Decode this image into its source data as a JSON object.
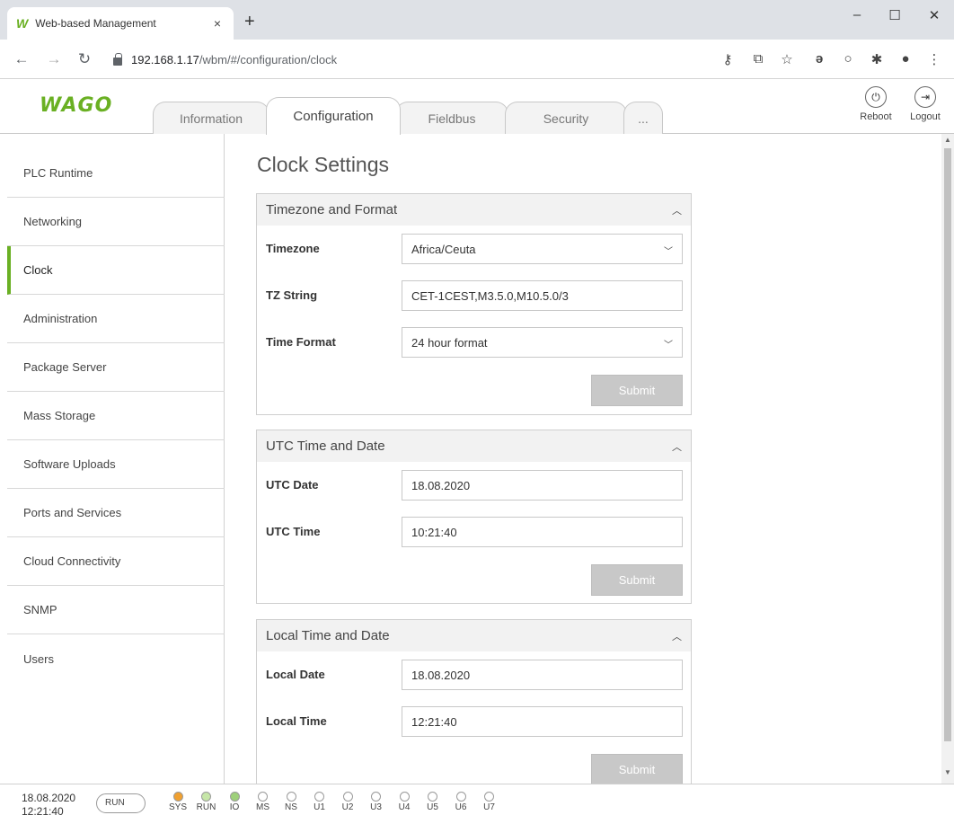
{
  "browser": {
    "tab_title": "Web-based Management",
    "tab_favicon": "W",
    "tab_close": "×",
    "new_tab": "+",
    "win_minimize": "–",
    "win_maximize": "☐",
    "win_close": "✕",
    "url_host": "192.168.1.17",
    "url_path": "/wbm/#/configuration/clock"
  },
  "app": {
    "logo": "WAGO",
    "tabs": [
      {
        "label": "Information"
      },
      {
        "label": "Configuration"
      },
      {
        "label": "Fieldbus"
      },
      {
        "label": "Security"
      },
      {
        "label": "..."
      }
    ],
    "reboot_label": "Reboot",
    "logout_label": "Logout"
  },
  "sidebar": {
    "items": [
      {
        "label": "PLC Runtime"
      },
      {
        "label": "Networking"
      },
      {
        "label": "Clock"
      },
      {
        "label": "Administration"
      },
      {
        "label": "Package Server"
      },
      {
        "label": "Mass Storage"
      },
      {
        "label": "Software Uploads"
      },
      {
        "label": "Ports and Services"
      },
      {
        "label": "Cloud Connectivity"
      },
      {
        "label": "SNMP"
      },
      {
        "label": "Users"
      }
    ]
  },
  "page": {
    "title": "Clock Settings",
    "timezone_panel": {
      "title": "Timezone and Format",
      "timezone_label": "Timezone",
      "timezone_value": "Africa/Ceuta",
      "tzstring_label": "TZ String",
      "tzstring_value": "CET-1CEST,M3.5.0,M10.5.0/3",
      "timeformat_label": "Time Format",
      "timeformat_value": "24 hour format",
      "submit_label": "Submit"
    },
    "utc_panel": {
      "title": "UTC Time and Date",
      "date_label": "UTC Date",
      "date_value": "18.08.2020",
      "time_label": "UTC Time",
      "time_value": "10:21:40",
      "submit_label": "Submit"
    },
    "local_panel": {
      "title": "Local Time and Date",
      "date_label": "Local Date",
      "date_value": "18.08.2020",
      "time_label": "Local Time",
      "time_value": "12:21:40",
      "submit_label": "Submit"
    }
  },
  "status": {
    "date": "18.08.2020",
    "time": "12:21:40",
    "run_label": "RUN",
    "leds": [
      {
        "label": "SYS",
        "color": "#f0a030"
      },
      {
        "label": "RUN",
        "color": "#c6e6a8"
      },
      {
        "label": "IO",
        "color": "#9ed07a"
      },
      {
        "label": "MS",
        "color": "#ffffff"
      },
      {
        "label": "NS",
        "color": "#ffffff"
      },
      {
        "label": "U1",
        "color": "#ffffff"
      },
      {
        "label": "U2",
        "color": "#ffffff"
      },
      {
        "label": "U3",
        "color": "#ffffff"
      },
      {
        "label": "U4",
        "color": "#ffffff"
      },
      {
        "label": "U5",
        "color": "#ffffff"
      },
      {
        "label": "U6",
        "color": "#ffffff"
      },
      {
        "label": "U7",
        "color": "#ffffff"
      }
    ]
  },
  "colors": {
    "accent": "#6ab023",
    "submit_disabled": "#c8c8c8"
  }
}
